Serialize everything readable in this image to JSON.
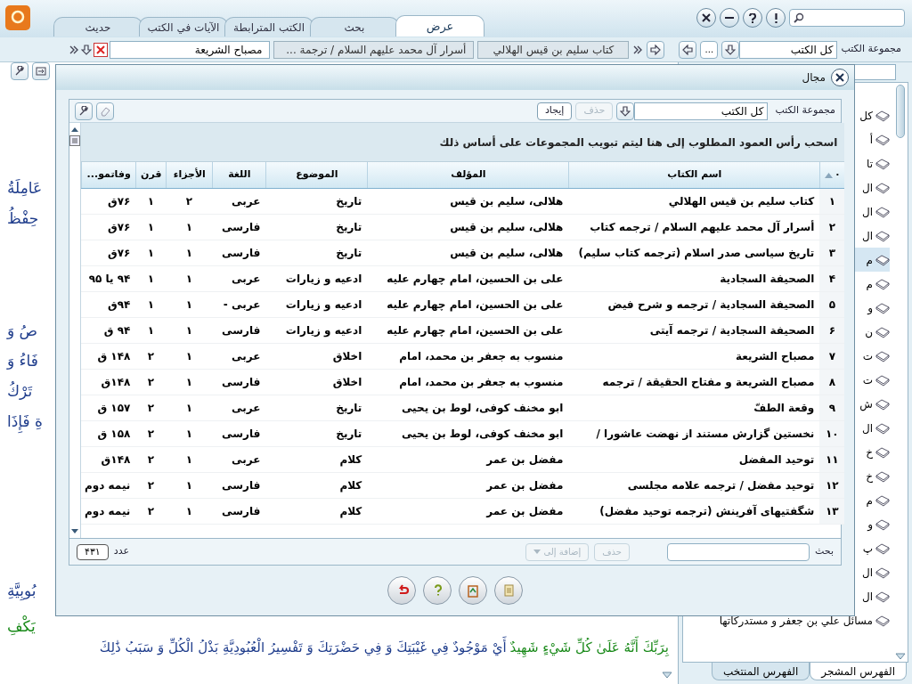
{
  "app": {
    "tabs": [
      {
        "label": "عرض",
        "selected": true
      },
      {
        "label": "بحث",
        "selected": false
      },
      {
        "label": "الكتب المترابطة",
        "selected": false
      },
      {
        "label": "الآيات في الكتب",
        "selected": false
      },
      {
        "label": "حديث",
        "selected": false
      }
    ]
  },
  "toolbar": {
    "collection_label": "مجموعة الكتب",
    "collection_value": "كل الكتب",
    "more": "...",
    "open_books": [
      "كتاب سليم بن قيس الهلالي",
      "أسرار آل محمد عليهم السلام / ترجمة ..."
    ],
    "current_book": "مصباح الشريعة"
  },
  "reader": {
    "fragments": [
      {
        "text": "عَامِلَةُ",
        "color": "#1f3d8c"
      },
      {
        "text": "حِفْظُ",
        "color": "#1f3d8c"
      },
      {
        "text": "صُ وَ",
        "color": "#1f3d8c"
      },
      {
        "text": "فَاءُ وَ",
        "color": "#1f3d8c"
      },
      {
        "text": "تَرْكُ",
        "color": "#1f3d8c"
      },
      {
        "text": "ةِ فَإِذَا",
        "color": "#1f3d8c"
      },
      {
        "text": "بُوبِيَّةِ",
        "color": "#1f3d8c"
      },
      {
        "text": "يَكْفِ",
        "color": "#1a8a1a"
      }
    ],
    "verse": [
      {
        "text": "بِرَبِّكَ أَنَّهُ عَلَىٰ كُلِّ شَيْءٍ شَهِيدٌ",
        "color": "#1a8a1a"
      },
      {
        "text": "أَيْ مَوْجُودٌ فِي غَيْبَتِكَ وَ فِي حَضْرَتِكَ وَ تَفْسِيرُ الْعُبُودِيَّةِ بَذْلُ الْكُلِّ وَ سَبَبُ ذَٰلِكَ",
        "color": "#1f3d8c"
      }
    ]
  },
  "sidebar": {
    "items": [
      {
        "label": "كل",
        "selected": false
      },
      {
        "label": "أ",
        "selected": false
      },
      {
        "label": "تا",
        "selected": false
      },
      {
        "label": "ال",
        "selected": false
      },
      {
        "label": "ال",
        "selected": false
      },
      {
        "label": "ال",
        "selected": false
      },
      {
        "label": "م",
        "selected": true
      },
      {
        "label": "م",
        "selected": false
      },
      {
        "label": "و",
        "selected": false
      },
      {
        "label": "ن",
        "selected": false
      },
      {
        "label": "ت",
        "selected": false
      },
      {
        "label": "ت",
        "selected": false
      },
      {
        "label": "ش",
        "selected": false
      },
      {
        "label": "ال",
        "selected": false
      },
      {
        "label": "خ",
        "selected": false
      },
      {
        "label": "خ",
        "selected": false
      },
      {
        "label": "م",
        "selected": false
      },
      {
        "label": "و",
        "selected": false
      },
      {
        "label": "پ",
        "selected": false
      },
      {
        "label": "ال",
        "selected": false
      },
      {
        "label": "ال",
        "selected": false
      },
      {
        "label": "مسائل علي بن جعفر و مستدركاتها",
        "selected": false
      }
    ],
    "tabs": [
      {
        "label": "الفهرس المشجر",
        "selected": true
      },
      {
        "label": "الفهرس المنتخب",
        "selected": false
      }
    ]
  },
  "dialog": {
    "title": "مجال",
    "collection_label": "مجموعة الكتب",
    "collection_value": "كل الكتب",
    "buttons": [
      {
        "label": "حذف",
        "disabled": true
      },
      {
        "label": "إيجاد",
        "disabled": false
      }
    ],
    "group_hint": "اسحب رأس العمود المطلوب إلى هنا ليتم تبويب المجموعات على أساس ذلك",
    "table": {
      "columns": [
        "٠",
        "اسم الكتاب",
        "المؤلف",
        "الموضوع",
        "اللغة",
        "الأجزاء",
        "قرن",
        "وفاتمو..."
      ],
      "rows": [
        [
          "۱",
          "كتاب سليم بن قيس الهلالي",
          "هلالى، سليم بن قيس",
          "تاريخ",
          "عربى",
          "۲",
          "۱",
          "۷۶ق"
        ],
        [
          "۲",
          "أسرار آل محمد عليهم السلام / ترجمه كتاب",
          "هلالى، سليم بن قيس",
          "تاريخ",
          "فارسى",
          "۱",
          "۱",
          "۷۶ق"
        ],
        [
          "۳",
          "تاريخ سياسى صدر اسلام (ترجمه كتاب سليم)",
          "هلالى، سليم بن قيس",
          "تاريخ",
          "فارسى",
          "۱",
          "۱",
          "۷۶ق"
        ],
        [
          "۴",
          "الصحيفة السجادية",
          "على بن الحسين، امام چهارم عليه",
          "ادعيه و زيارات",
          "عربى",
          "۱",
          "۱",
          "۹۴ يا ۹۵"
        ],
        [
          "۵",
          "الصحيفة السجادية / ترجمه و شرح فيض",
          "على بن الحسين، امام چهارم عليه",
          "ادعيه و زيارات",
          "عربى -",
          "۱",
          "۱",
          "۹۴ق"
        ],
        [
          "۶",
          "الصحيفة السجادية / ترجمه آيتى",
          "على بن الحسين، امام چهارم عليه",
          "ادعيه و زيارات",
          "فارسى",
          "۱",
          "۱",
          "۹۴ ق"
        ],
        [
          "۷",
          "مصباح الشريعة",
          "منسوب به جعفر بن محمد، امام",
          "اخلاق",
          "عربى",
          "۱",
          "۲",
          "۱۴۸ ق"
        ],
        [
          "۸",
          "مصباح الشريعة و مفتاح الحقيقة / ترجمه",
          "منسوب به جعفر بن محمد، امام",
          "اخلاق",
          "فارسى",
          "۱",
          "۲",
          "۱۴۸ق"
        ],
        [
          "۹",
          "وقعة الطفّ",
          "ابو مخنف كوفى، لوط بن يحيى",
          "تاريخ",
          "عربى",
          "۱",
          "۲",
          "۱۵۷ ق"
        ],
        [
          "۱۰",
          "نخستين گزارش مستند از نهضت عاشورا /",
          "ابو مخنف كوفى، لوط بن يحيى",
          "تاريخ",
          "فارسى",
          "۱",
          "۲",
          "۱۵۸ ق"
        ],
        [
          "۱۱",
          "توحيد المفضل",
          "مفضل بن عمر",
          "كلام",
          "عربى",
          "۱",
          "۲",
          "۱۴۸ق"
        ],
        [
          "۱۲",
          "توحيد مفضل / ترجمه علامه مجلسى",
          "مفضل بن عمر",
          "كلام",
          "فارسى",
          "۱",
          "۲",
          "نيمه دوم"
        ],
        [
          "۱۳",
          "شگفتيهاى آفرينش (ترجمه توحيد مفضل)",
          "مفضل بن عمر",
          "كلام",
          "فارسى",
          "۱",
          "۲",
          "نيمه دوم"
        ]
      ]
    },
    "search_label": "بحث",
    "footer_buttons": [
      {
        "label": "حذف",
        "disabled": true,
        "kind": "plain"
      },
      {
        "label": "إضافة إلى",
        "disabled": true,
        "kind": "dropdown"
      }
    ],
    "count_label": "عدد",
    "count": "۴۳۱"
  }
}
